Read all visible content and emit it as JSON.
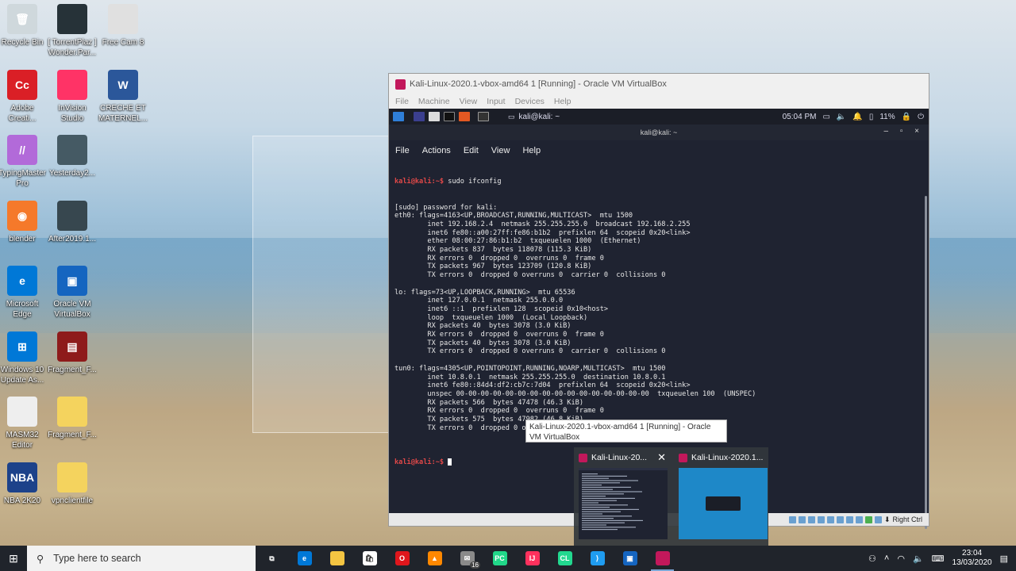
{
  "desktop": {
    "icons": [
      {
        "label": "Recycle Bin",
        "color": "#cfd8dc",
        "glyph": "🗑"
      },
      {
        "label": "[ TorrentPlaz ] Wonder.Par...",
        "color": "#263238",
        "glyph": ""
      },
      {
        "label": "Free Cam 8",
        "color": "#e0e0e0",
        "glyph": ""
      },
      {
        "label": "Adobe Creati...",
        "color": "#da1f26",
        "glyph": "Cc"
      },
      {
        "label": "InVision Studio",
        "color": "#ff3366",
        "glyph": ""
      },
      {
        "label": "CRECHE ET MATERNEL...",
        "color": "#2b579a",
        "glyph": "W"
      },
      {
        "label": "TypingMaster Pro",
        "color": "#b26ad9",
        "glyph": "//"
      },
      {
        "label": "Yesterday2...",
        "color": "#455a64",
        "glyph": ""
      },
      {
        "label": "blender",
        "color": "#f5792a",
        "glyph": "◉"
      },
      {
        "label": "After2019.1...",
        "color": "#37474f",
        "glyph": ""
      },
      {
        "label": "Microsoft Edge",
        "color": "#0078d7",
        "glyph": "e"
      },
      {
        "label": "Oracle VM VirtualBox",
        "color": "#1565c0",
        "glyph": "▣"
      },
      {
        "label": "Windows 10 Update As...",
        "color": "#0078d7",
        "glyph": "⊞"
      },
      {
        "label": "Fragment_F...",
        "color": "#8e1b1b",
        "glyph": "▤"
      },
      {
        "label": "MASM32 Editor",
        "color": "#eeeeee",
        "glyph": ""
      },
      {
        "label": "Fragment_F...",
        "color": "#f4d35e",
        "glyph": ""
      },
      {
        "label": "NBA 2K20",
        "color": "#1d428a",
        "glyph": "NBA"
      },
      {
        "label": "vpnclientfile",
        "color": "#f4d35e",
        "glyph": ""
      }
    ]
  },
  "vbox": {
    "title": "Kali-Linux-2020.1-vbox-amd64 1 [Running] - Oracle VM VirtualBox",
    "menu": [
      "File",
      "Machine",
      "View",
      "Input",
      "Devices",
      "Help"
    ],
    "status_right": "Right Ctrl"
  },
  "kali": {
    "task_label": "kali@kali: ~",
    "time": "05:04 PM",
    "battery": "11%",
    "term_title": "kali@kali: ~",
    "term_menu": [
      "File",
      "Actions",
      "Edit",
      "View",
      "Help"
    ],
    "prompt": "kali@kali:~$",
    "command": " sudo ifconfig",
    "output": [
      "[sudo] password for kali:",
      "eth0: flags=4163<UP,BROADCAST,RUNNING,MULTICAST>  mtu 1500",
      "        inet 192.168.2.4  netmask 255.255.255.0  broadcast 192.168.2.255",
      "        inet6 fe80::a00:27ff:fe86:b1b2  prefixlen 64  scopeid 0x20<link>",
      "        ether 08:00:27:86:b1:b2  txqueuelen 1000  (Ethernet)",
      "        RX packets 837  bytes 118078 (115.3 KiB)",
      "        RX errors 0  dropped 0  overruns 0  frame 0",
      "        TX packets 967  bytes 123709 (120.8 KiB)",
      "        TX errors 0  dropped 0 overruns 0  carrier 0  collisions 0",
      "",
      "lo: flags=73<UP,LOOPBACK,RUNNING>  mtu 65536",
      "        inet 127.0.0.1  netmask 255.0.0.0",
      "        inet6 ::1  prefixlen 128  scopeid 0x10<host>",
      "        loop  txqueuelen 1000  (Local Loopback)",
      "        RX packets 40  bytes 3078 (3.0 KiB)",
      "        RX errors 0  dropped 0  overruns 0  frame 0",
      "        TX packets 40  bytes 3078 (3.0 KiB)",
      "        TX errors 0  dropped 0 overruns 0  carrier 0  collisions 0",
      "",
      "tun0: flags=4305<UP,POINTOPOINT,RUNNING,NOARP,MULTICAST>  mtu 1500",
      "        inet 10.8.0.1  netmask 255.255.255.0  destination 10.8.0.1",
      "        inet6 fe80::84d4:df2:cb7c:7d04  prefixlen 64  scopeid 0x20<link>",
      "        unspec 00-00-00-00-00-00-00-00-00-00-00-00-00-00-00-00  txqueuelen 100  (UNSPEC)",
      "        RX packets 566  bytes 47478 (46.3 KiB)",
      "        RX errors 0  dropped 0  overruns 0  frame 0",
      "        TX packets 575  bytes 47982 (46.8 KiB)",
      "        TX errors 0  dropped 0 overruns 0  carrier 0  collisions 0",
      ""
    ]
  },
  "tooltip": "Kali-Linux-2020.1-vbox-amd64 1 [Running] - Oracle VM VirtualBox",
  "thumbnails": [
    {
      "label": "Kali-Linux-20..."
    },
    {
      "label": "Kali-Linux-2020.1..."
    }
  ],
  "taskbar": {
    "search_placeholder": "Type here to search",
    "apps": [
      {
        "name": "task-view-icon",
        "color": "#20242b",
        "glyph": "⧉"
      },
      {
        "name": "edge-icon",
        "color": "#0078d7",
        "glyph": "e"
      },
      {
        "name": "file-explorer-icon",
        "color": "#f4c542",
        "glyph": ""
      },
      {
        "name": "store-icon",
        "color": "#ffffff",
        "glyph": "🛍"
      },
      {
        "name": "opera-icon",
        "color": "#e0161c",
        "glyph": "O"
      },
      {
        "name": "vlc-icon",
        "color": "#ff8800",
        "glyph": "▲"
      },
      {
        "name": "mail-icon",
        "color": "#8a8a8a",
        "glyph": "✉"
      },
      {
        "name": "pycharm-icon",
        "color": "#21d789",
        "glyph": "PC"
      },
      {
        "name": "intellij-icon",
        "color": "#fe315d",
        "glyph": "IJ"
      },
      {
        "name": "clion-icon",
        "color": "#22d88f",
        "glyph": "CL"
      },
      {
        "name": "vscode-icon",
        "color": "#1f9cf0",
        "glyph": "⟩"
      },
      {
        "name": "virtualbox-icon",
        "color": "#1565c0",
        "glyph": "▣"
      },
      {
        "name": "kali-vm-icon",
        "color": "#c2185b",
        "glyph": ""
      }
    ],
    "mail_badge": "16",
    "time": "23:04",
    "date": "13/03/2020"
  }
}
